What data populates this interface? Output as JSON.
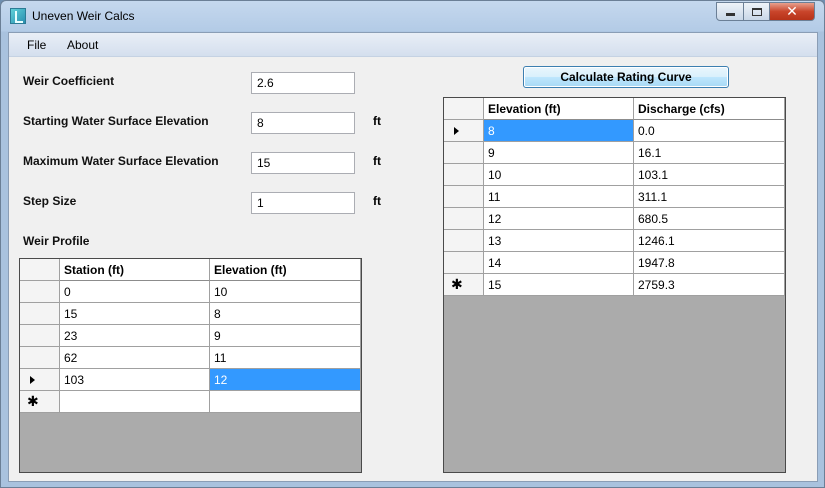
{
  "window": {
    "title": "Uneven Weir Calcs"
  },
  "menu": {
    "file": "File",
    "about": "About"
  },
  "form": {
    "weir_coefficient": {
      "label": "Weir Coefficient",
      "value": "2.6"
    },
    "start_wse": {
      "label": "Starting Water Surface Elevation",
      "value": "8",
      "unit": "ft"
    },
    "max_wse": {
      "label": "Maximum Water Surface Elevation",
      "value": "15",
      "unit": "ft"
    },
    "step_size": {
      "label": "Step Size",
      "value": "1",
      "unit": "ft"
    },
    "weir_profile_label": "Weir Profile"
  },
  "button": {
    "calculate": "Calculate Rating Curve"
  },
  "profile_grid": {
    "columns": [
      "Station (ft)",
      "Elevation (ft)"
    ],
    "rows": [
      [
        "0",
        "10"
      ],
      [
        "15",
        "8"
      ],
      [
        "23",
        "9"
      ],
      [
        "62",
        "11"
      ],
      [
        "103",
        "12"
      ]
    ]
  },
  "rating_grid": {
    "columns": [
      "Elevation (ft)",
      "Discharge (cfs)"
    ],
    "rows": [
      [
        "8",
        "0.0"
      ],
      [
        "9",
        "16.1"
      ],
      [
        "10",
        "103.1"
      ],
      [
        "11",
        "311.1"
      ],
      [
        "12",
        "680.5"
      ],
      [
        "13",
        "1246.1"
      ],
      [
        "14",
        "1947.8"
      ],
      [
        "15",
        "2759.3"
      ]
    ]
  },
  "icons": {
    "app": "app-icon",
    "minimize": "minimize-icon",
    "maximize": "maximize-icon",
    "close": "close-icon",
    "row_current": "row-arrow-icon",
    "row_new": "new-row-asterisk-icon"
  },
  "colors": {
    "selection": "#3399ff",
    "grid_background": "#ababab"
  }
}
